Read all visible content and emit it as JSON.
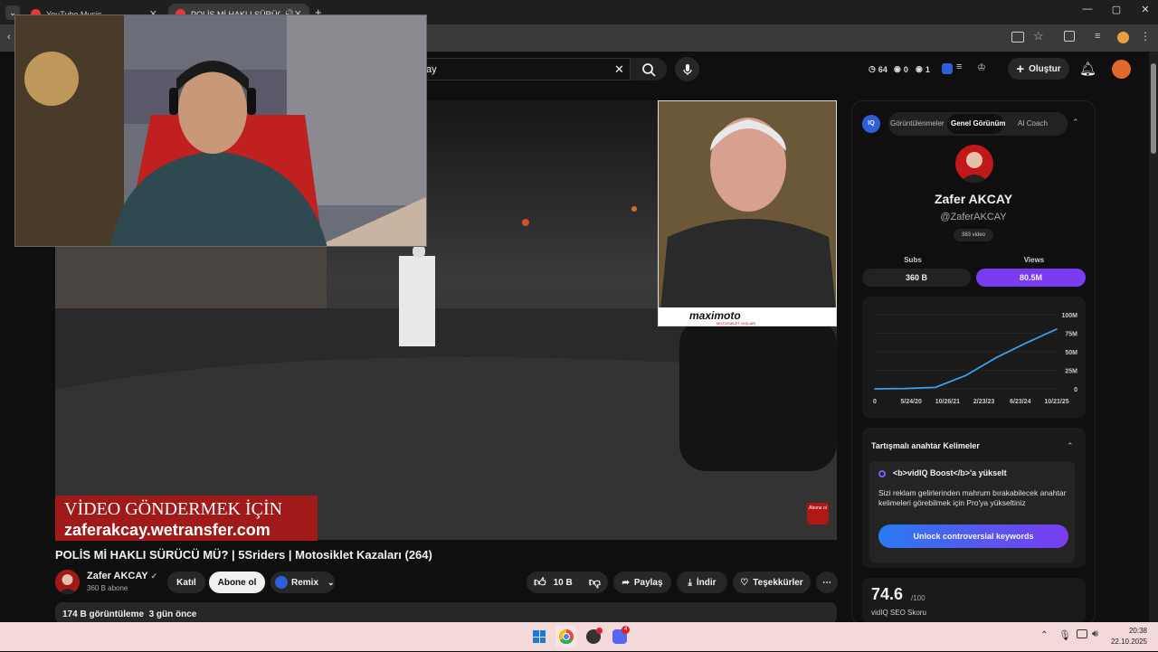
{
  "browser": {
    "tabs": [
      {
        "label": "YouTube Music",
        "active": false
      },
      {
        "label": "POLİS Mİ HAKLI SÜRÜCÜ M",
        "active": true
      }
    ],
    "new_tab": "+",
    "window_controls": [
      "—",
      "▢",
      "✕"
    ]
  },
  "header": {
    "search_value": "ay",
    "stats": [
      {
        "icon": "clock-icon",
        "value": "64"
      },
      {
        "icon": "eye-icon",
        "value": "0"
      },
      {
        "icon": "eye-icon",
        "value": "1"
      }
    ],
    "create_label": "Oluştur"
  },
  "video": {
    "banner_line1": "VİDEO GÖNDERMEK İÇİN",
    "banner_line2": "zaferakcay.wetransfer.com",
    "inset_brand": "maximoto",
    "inset_sub": "MOTOSİKLET YAŞLARI",
    "corner_badge": "Abone ol"
  },
  "meta": {
    "title": "POLİS Mİ HAKLI SÜRÜCÜ MÜ? | 5Sriders | Motosiklet Kazaları (264)",
    "channel": "Zafer AKCAY",
    "subs": "360 B abone",
    "join": "Katıl",
    "subscribe": "Abone ol",
    "remix": "Remix",
    "likes": "10 B",
    "share": "Paylaş",
    "download": "İndir",
    "thanks": "Teşekkürler",
    "views_line": "174 B görüntüleme  3 gün önce"
  },
  "vidiq": {
    "tabs": [
      "Görüntülenmeler",
      "Genel Görünüm",
      "AI Coach"
    ],
    "channel_name": "Zafer AKCAY",
    "handle": "@ZaferAKCAY",
    "video_count": "383 video",
    "subs_label": "Subs",
    "views_label": "Views",
    "subs_value": "360 B",
    "views_value": "80.5M",
    "controversial_title": "Tartışmalı anahtar Kelimeler",
    "boost_title": "<b>vidIQ Boost</b>'a yükselt",
    "boost_text": "Sizi reklam gelirlerinden mahrum bırakabilecek anahtar kelimeleri görebilmek için Pro'ya yükseltiniz",
    "unlock_label": "Unlock controversial keywords",
    "seo_score": "74.6",
    "seo_max": "/100",
    "seo_label": "vidIQ SEO Skoru"
  },
  "chart_data": {
    "type": "line",
    "x": [
      "0",
      "5/24/20",
      "10/26/21",
      "2/23/23",
      "6/23/24",
      "10/21/25"
    ],
    "yticks": [
      "100M",
      "75M",
      "50M",
      "25M",
      "0"
    ],
    "ylim": [
      0,
      100
    ],
    "series": [
      {
        "values": [
          0,
          0.5,
          2,
          18,
          42,
          62,
          80.5
        ]
      }
    ]
  },
  "taskbar": {
    "time": "20:38",
    "date": "22.10.2025",
    "discord_badge": "4"
  }
}
